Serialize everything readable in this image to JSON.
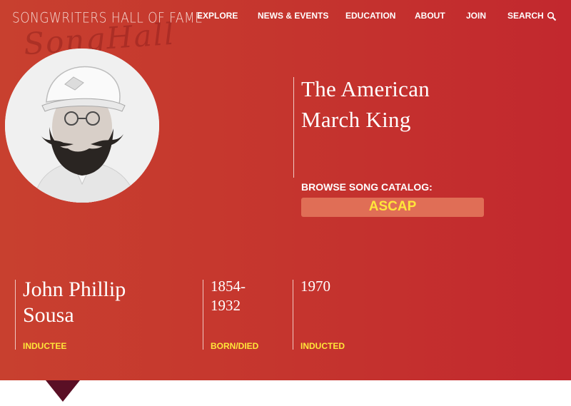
{
  "logo": {
    "text": "SONGWRITERS HALL OF FAME",
    "script": "SongHall"
  },
  "nav": {
    "items": [
      "EXPLORE",
      "NEWS & EVENTS",
      "EDUCATION",
      "ABOUT",
      "JOIN"
    ],
    "search_label": "SEARCH"
  },
  "hero": {
    "tagline_line1": "The American",
    "tagline_line2": "March King",
    "browse_label": "BROWSE SONG CATALOG:",
    "catalog_button": "ASCAP"
  },
  "info": {
    "name_line1": "John Phillip",
    "name_line2": "Sousa",
    "name_label": "INDUCTEE",
    "born_died_line1": "1854-",
    "born_died_line2": "1932",
    "born_died_label": "BORN/DIED",
    "inducted_year": "1970",
    "inducted_label": "INDUCTED"
  },
  "colors": {
    "hero_start": "#c8402f",
    "hero_end": "#c2282e",
    "accent_yellow": "#ffe63a",
    "button_bg": "#e06e56",
    "pointer": "#5a0f25"
  }
}
